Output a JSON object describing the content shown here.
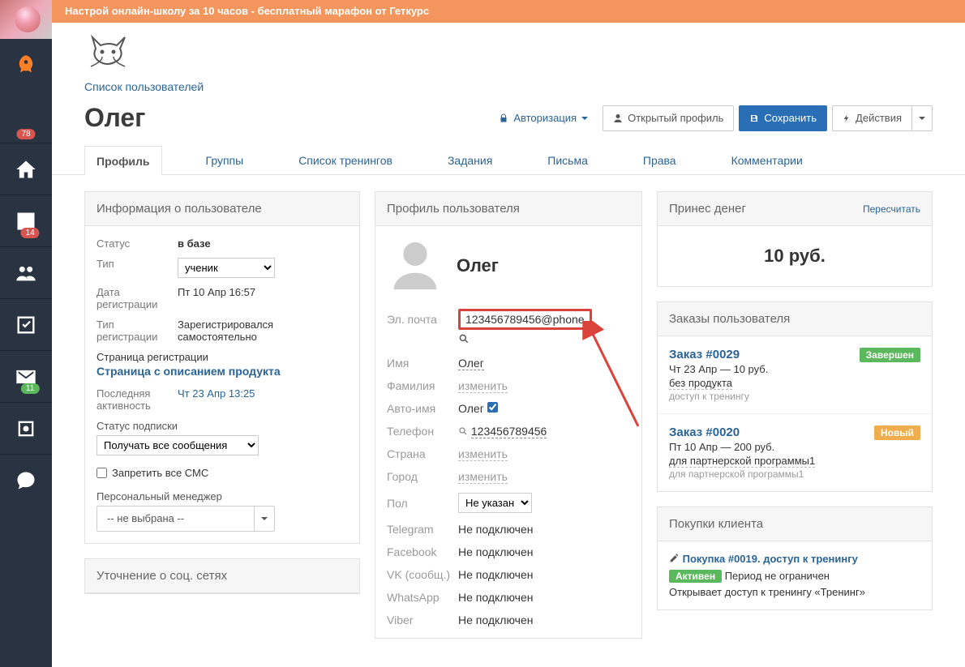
{
  "banner": "Настрой онлайн-школу за 10 часов - бесплатный марафон от Геткурс",
  "side": {
    "badge1": "78",
    "badge2": "14",
    "badge3": "11"
  },
  "breadcrumb": "Список пользователей",
  "page_title": "Олег",
  "actions": {
    "auth": "Авторизация",
    "open": "Открытый профиль",
    "save": "Сохранить",
    "menu": "Действия"
  },
  "tabs": [
    "Профиль",
    "Группы",
    "Список тренингов",
    "Задания",
    "Письма",
    "Права",
    "Комментарии"
  ],
  "info": {
    "head": "Информация о пользователе",
    "status_l": "Статус",
    "status_v": "в базе",
    "type_l": "Тип",
    "type_v": "ученик",
    "reg_l": "Дата регистрации",
    "reg_v": "Пт 10 Апр 16:57",
    "regtype_l": "Тип регистрации",
    "regtype_v": "Зарегистрировался самостоятельно",
    "regpage_l": "Страница регистрации",
    "regpage_link": "Страница с описанием продукта",
    "last_l": "Последняя активность",
    "last_v": "Чт 23 Апр 13:25",
    "sub_l": "Статус подписки",
    "sub_v": "Получать все сообщения",
    "forbid_sms": "Запретить все СМС",
    "manager_l": "Персональный менеджер",
    "manager_v": "-- не выбрана --"
  },
  "social_head": "Уточнение о соц. сетях",
  "profile": {
    "head": "Профиль пользователя",
    "name": "Олег",
    "email_l": "Эл. почта",
    "email_v": "123456789456@phone",
    "name_l": "Имя",
    "name_v": "Олег",
    "lname_l": "Фамилия",
    "change": "изменить",
    "autoname_l": "Авто-имя",
    "autoname_v": "Олег",
    "phone_l": "Телефон",
    "phone_v": "123456789456",
    "country_l": "Страна",
    "city_l": "Город",
    "sex_l": "Пол",
    "sex_v": "Не указан",
    "tg_l": "Telegram",
    "notconn": "Не подключен",
    "fb_l": "Facebook",
    "vk_l": "VK (сообщ.)",
    "wa_l": "WhatsApp",
    "vb_l": "Viber"
  },
  "money": {
    "head": "Принес денег",
    "recalc": "Пересчитать",
    "value": "10 руб."
  },
  "orders": {
    "head": "Заказы пользователя",
    "o1": {
      "title": "Заказ #0029",
      "date": "Чт 23 Апр — 10 руб.",
      "product": "без продукта",
      "small": "доступ к тренингу",
      "status": "Завершен"
    },
    "o2": {
      "title": "Заказ #0020",
      "date": "Пт 10 Апр — 200 руб.",
      "product": "для партнерской программы1",
      "small": "для партнерской программы1",
      "status": "Новый"
    }
  },
  "purchases": {
    "head": "Покупки клиента",
    "p1": {
      "title": "Покупка #0019. доступ к тренингу",
      "status": "Активен",
      "period": "Период не ограничен",
      "desc": "Открывает доступ к тренингу «Тренинг»"
    }
  }
}
